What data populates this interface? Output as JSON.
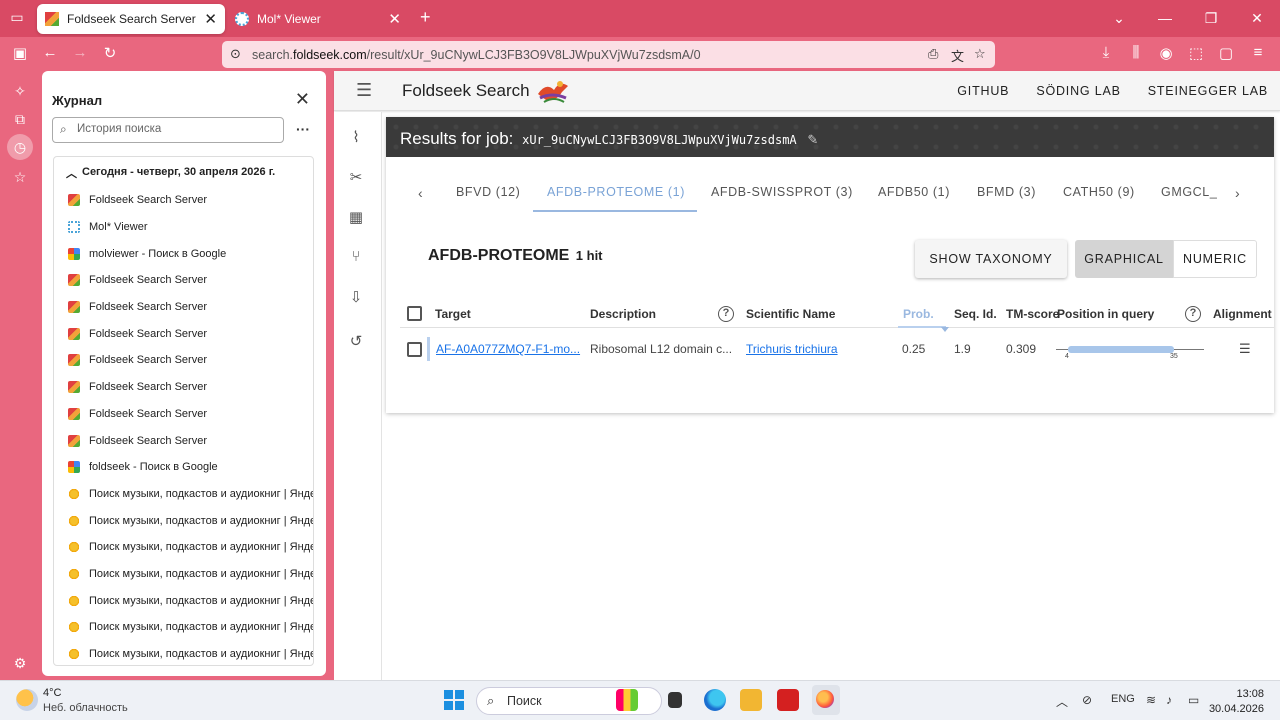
{
  "browser": {
    "tabs": [
      {
        "title": "Foldseek Search Server",
        "active": true
      },
      {
        "title": "Mol* Viewer",
        "active": false
      }
    ],
    "url_prefix": "search.",
    "url_domain": "foldseek.com",
    "url_path": "/result/xUr_9uCNywLCJ3FB3O9V8LJWpuXVjWu7zsdsmA/0"
  },
  "history": {
    "title": "Журнал",
    "search_placeholder": "История поиска",
    "group_label": "Сегодня - четверг, 30 апреля 2026 г.",
    "items": [
      {
        "title": "Foldseek Search Server",
        "icon": "fs"
      },
      {
        "title": "Mol* Viewer",
        "icon": "mol"
      },
      {
        "title": "molviewer - Поиск в Google",
        "icon": "g"
      },
      {
        "title": "Foldseek Search Server",
        "icon": "fs"
      },
      {
        "title": "Foldseek Search Server",
        "icon": "fs"
      },
      {
        "title": "Foldseek Search Server",
        "icon": "fs"
      },
      {
        "title": "Foldseek Search Server",
        "icon": "fs"
      },
      {
        "title": "Foldseek Search Server",
        "icon": "fs"
      },
      {
        "title": "Foldseek Search Server",
        "icon": "fs"
      },
      {
        "title": "Foldseek Search Server",
        "icon": "fs"
      },
      {
        "title": "foldseek - Поиск в Google",
        "icon": "g"
      },
      {
        "title": "Поиск музыки, подкастов и аудиокниг | Янде...",
        "icon": "ya"
      },
      {
        "title": "Поиск музыки, подкастов и аудиокниг | Янде...",
        "icon": "ya"
      },
      {
        "title": "Поиск музыки, подкастов и аудиокниг | Янде...",
        "icon": "ya"
      },
      {
        "title": "Поиск музыки, подкастов и аудиокниг | Янде...",
        "icon": "ya"
      },
      {
        "title": "Поиск музыки, подкастов и аудиокниг | Янде...",
        "icon": "ya"
      },
      {
        "title": "Поиск музыки, подкастов и аудиокниг | Янде...",
        "icon": "ya"
      },
      {
        "title": "Поиск музыки, подкастов и аудиокниг | Янде...",
        "icon": "ya"
      }
    ]
  },
  "app": {
    "brand": "Foldseek Search",
    "links": [
      "GITHUB",
      "SÖDING LAB",
      "STEINEGGER LAB"
    ],
    "job_label": "Results for job:",
    "job_id": "xUr_9uCNywLCJ3FB3O9V8LJWpuXVjWu7zsdsmA",
    "db_tabs": [
      "BFVD (12)",
      "AFDB-PROTEOME (1)",
      "AFDB-SWISSPROT (3)",
      "AFDB50 (1)",
      "BFMD (3)",
      "CATH50 (9)",
      "GMGCL_"
    ],
    "active_db_tab": 1,
    "db_title": "AFDB-PROTEOME",
    "hits_label": "1 hit",
    "buttons": {
      "taxonomy": "SHOW TAXONOMY",
      "graphical": "GRAPHICAL",
      "numeric": "NUMERIC"
    },
    "columns": {
      "target": "Target",
      "description": "Description",
      "sci_name": "Scientific Name",
      "prob": "Prob.",
      "seq_id": "Seq. Id.",
      "tm": "TM-score",
      "position": "Position in query",
      "alignment": "Alignment"
    },
    "rows": [
      {
        "target": "AF-A0A077ZMQ7-F1-mo...",
        "description": "Ribosomal L12 domain c...",
        "sci_name": "Trichuris trichiura",
        "prob": "0.25",
        "seq_id": "1.9",
        "tm": "0.309",
        "pos_start": "4",
        "pos_end": "35"
      }
    ]
  },
  "taskbar": {
    "temp": "4°C",
    "condition": "Неб. облачность",
    "search_placeholder": "Поиск",
    "lang": "ENG",
    "time": "13:08",
    "date": "30.04.2026"
  }
}
